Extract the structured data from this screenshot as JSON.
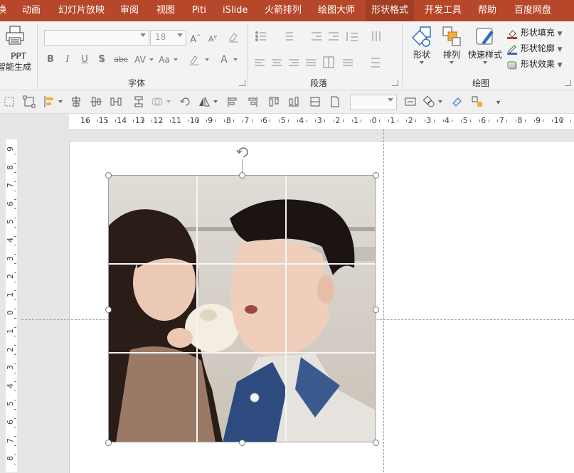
{
  "menu": {
    "items": [
      "换",
      "动画",
      "幻灯片放映",
      "审阅",
      "视图",
      "Piti",
      "iSlide",
      "火箭排列",
      "绘图大师",
      "形状格式",
      "开发工具",
      "帮助",
      "百度网盘"
    ],
    "active_index": 9
  },
  "ribbon": {
    "ppt_button": {
      "line1": "PPT",
      "line2": "智能生成"
    },
    "font": {
      "font_name_placeholder": "",
      "font_size_placeholder": "18",
      "group_label": "字体",
      "buttons": [
        "B",
        "I",
        "U",
        "S",
        "abc",
        "AV",
        "Aa",
        "A"
      ]
    },
    "paragraph": {
      "group_label": "段落"
    },
    "drawing": {
      "shape_label": "形状",
      "arrange_label": "排列",
      "quick_styles_label": "快速样式",
      "shape_fill_label": "形状填充",
      "shape_outline_label": "形状轮廓",
      "shape_effects_label": "形状效果",
      "group_label": "绘图"
    }
  },
  "toolbar2": {
    "dropdown_value": ""
  },
  "ruler_h": {
    "labels": [
      "16",
      "15",
      "14",
      "13",
      "12",
      "11",
      "10",
      "9",
      "8",
      "7",
      "6",
      "5",
      "4",
      "3",
      "2",
      "1",
      "0",
      "1",
      "2",
      "3",
      "4",
      "5",
      "6",
      "7",
      "8",
      "9",
      "10"
    ]
  },
  "ruler_v": {
    "labels": [
      "9",
      "8",
      "7",
      "6",
      "5",
      "4",
      "3",
      "2",
      "1",
      "0",
      "1",
      "2",
      "3",
      "4",
      "5",
      "6",
      "7",
      "8"
    ]
  },
  "colors": {
    "menubar": "#b7472a",
    "ribbon_bg": "#f3f3f3",
    "shape_fill_swatch": "#c0392b",
    "shape_outline_swatch": "#2e6fbf",
    "selection_handle": "#ffffff"
  }
}
